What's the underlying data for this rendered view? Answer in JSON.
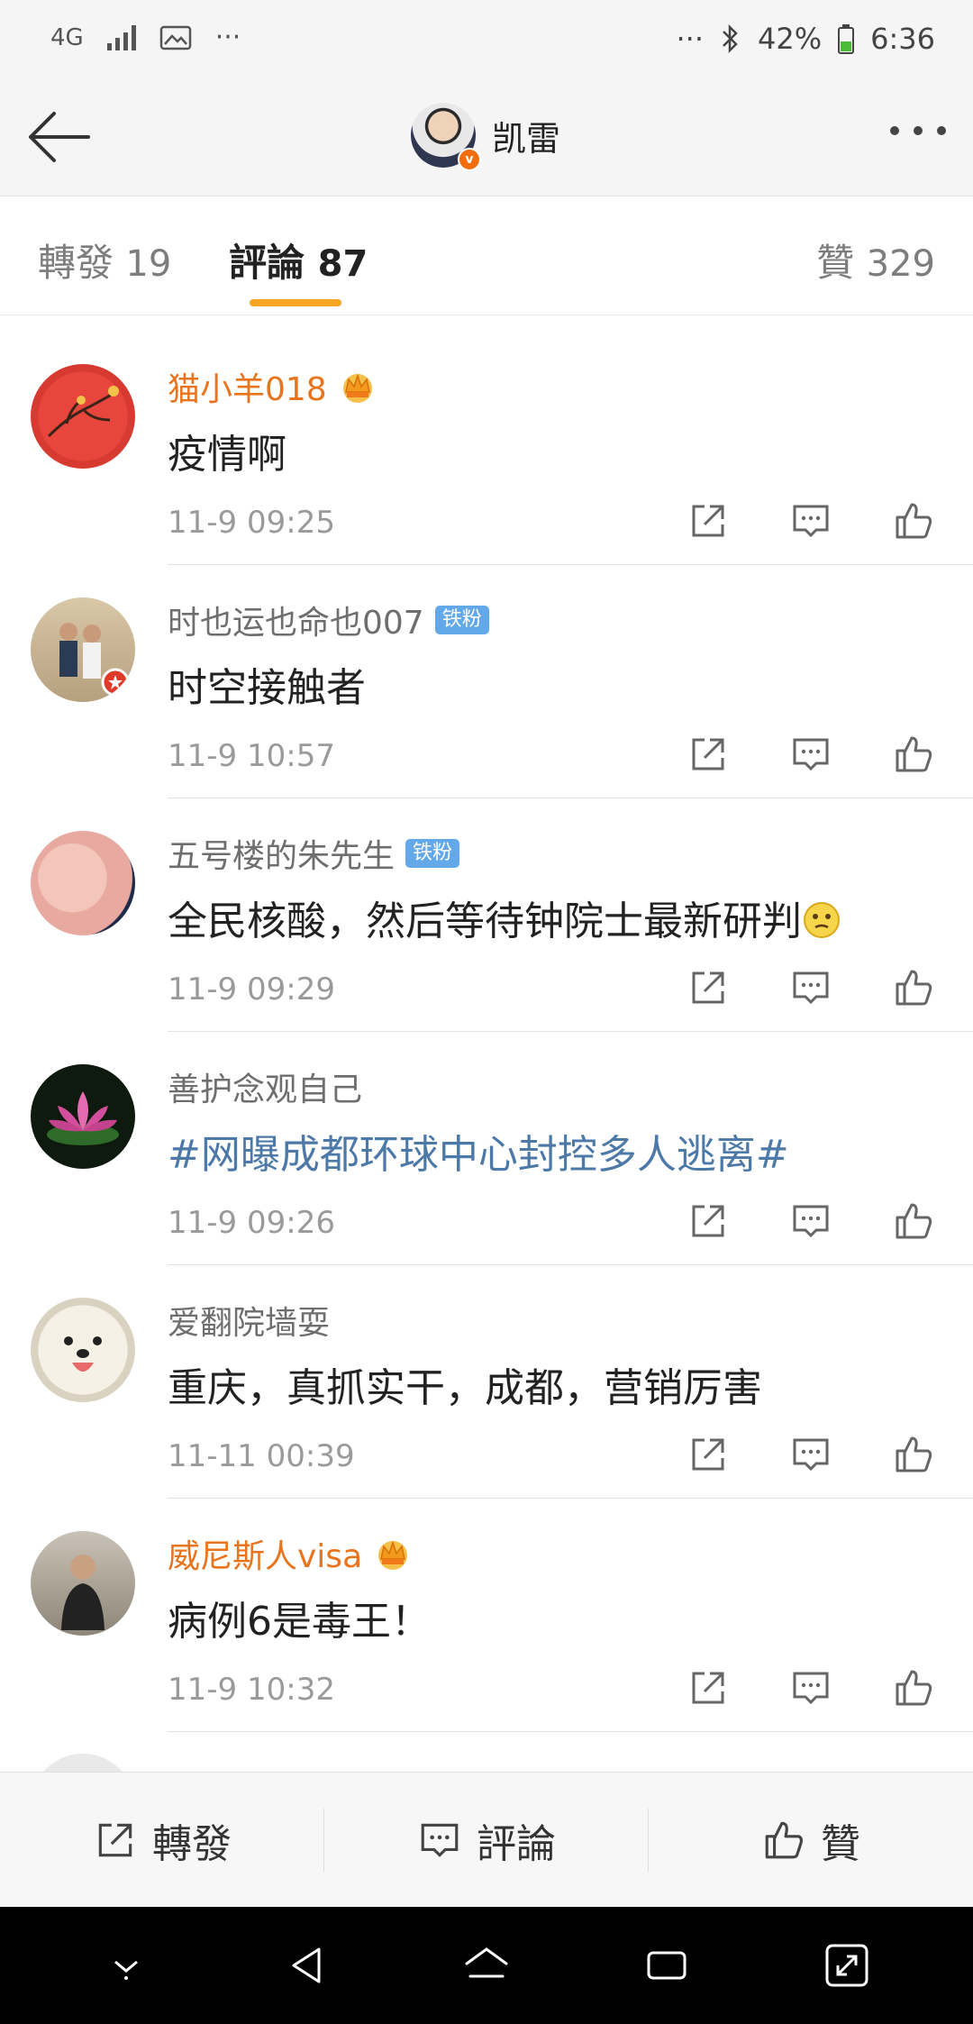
{
  "status_bar": {
    "network": "4G",
    "ellipsis_left": "···",
    "ellipsis_right": "···",
    "battery": "42%",
    "time": "6:36"
  },
  "header": {
    "title": "凯雷"
  },
  "tabs": [
    {
      "label": "轉發",
      "count": "19"
    },
    {
      "label": "評論",
      "count": "87"
    },
    {
      "label": "贊",
      "count": "329"
    }
  ],
  "comments": [
    {
      "name": "猫小羊018",
      "vip": true,
      "crown": true,
      "fan_badge": "",
      "text": "疫情啊",
      "topic": false,
      "time": "11-9 09:25"
    },
    {
      "name": "时也运也命也007",
      "vip": false,
      "crown": false,
      "fan_badge": "铁粉",
      "text": "时空接触者",
      "topic": false,
      "time": "11-9 10:57"
    },
    {
      "name": "五号楼的朱先生",
      "vip": false,
      "crown": false,
      "fan_badge": "铁粉",
      "text": "全民核酸，然后等待钟院士最新研判",
      "emoji": "thinking-emoji",
      "topic": false,
      "time": "11-9 09:29"
    },
    {
      "name": "善护念观自己",
      "vip": false,
      "crown": false,
      "fan_badge": "",
      "text": "#网曝成都环球中心封控多人逃离#",
      "topic": true,
      "time": "11-9 09:26"
    },
    {
      "name": "爱翻院墙耍",
      "vip": false,
      "crown": false,
      "fan_badge": "",
      "text": "重庆，真抓实干，成都，营销厉害",
      "topic": false,
      "time": "11-11 00:39"
    },
    {
      "name": "威尼斯人visa",
      "vip": true,
      "crown": true,
      "fan_badge": "",
      "text": "病例6是毒王！",
      "topic": false,
      "time": "11-9 10:32"
    }
  ],
  "bottom_bar": {
    "repost": "轉發",
    "comment": "評論",
    "like": "贊"
  },
  "colors": {
    "accent": "#f6a623",
    "vip_name": "#e8741e",
    "topic": "#4d79a8",
    "fan_badge": "#63a9ea"
  }
}
